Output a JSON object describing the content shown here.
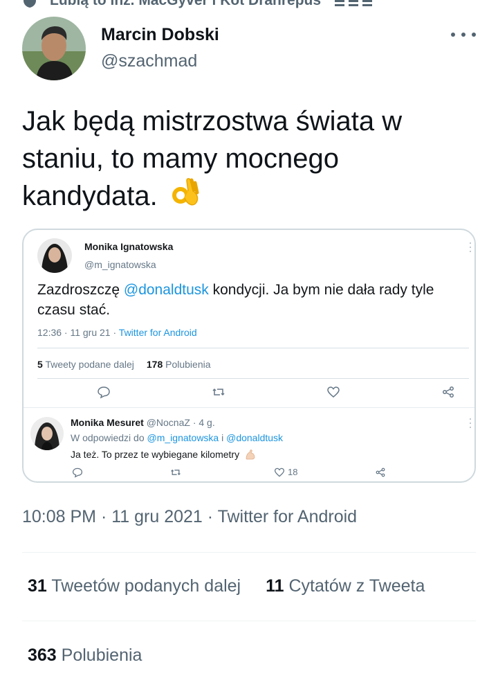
{
  "context": {
    "text": "Lubią to inż. MacGyver i Kot Drahrepus",
    "icon": "shield-icon"
  },
  "tweet": {
    "author_name": "Marcin Dobski",
    "author_handle": "@szachmad",
    "text": "Jak będą mistrzostwa świata w staniu, to mamy mocnego kandydata.",
    "emoji": "ok-hand-icon",
    "timestamp": "10:08 PM · 11 gru 2021 · Twitter for Android"
  },
  "embedded": {
    "author_name": "Monika Ignatowska",
    "author_handle": "@m_ignatowska",
    "text_before": "Zazdroszczę ",
    "mention": "@donaldtusk",
    "text_after": " kondycji. Ja bym nie dała rady tyle czasu stać.",
    "time": "12:36 · 11 gru 21 · ",
    "source": "Twitter for Android",
    "retweets_count": "5",
    "retweets_label": "Tweety podane dalej",
    "likes_count": "178",
    "likes_label": "Polubienia",
    "reply": {
      "author_name": "Monika Mesuret",
      "author_meta": " @NocnaZ · 4 g.",
      "in_reply_prefix": "W odpowiedzi do ",
      "mention_1": "@m_ignatowska",
      "joiner": " i ",
      "mention_2": "@donaldtusk",
      "text": "Ja też. To przez te wybiegane kilometry",
      "likes": "18"
    }
  },
  "stats": {
    "retweets_count": "31",
    "retweets_label": "Tweetów podanych dalej",
    "quotes_count": "11",
    "quotes_label": "Cytatów z Tweeta",
    "likes_count": "363",
    "likes_label": "Polubienia"
  },
  "colors": {
    "text": "#0f1419",
    "secondary": "#536471",
    "link": "#1b95e0",
    "border": "#cfd9de"
  }
}
